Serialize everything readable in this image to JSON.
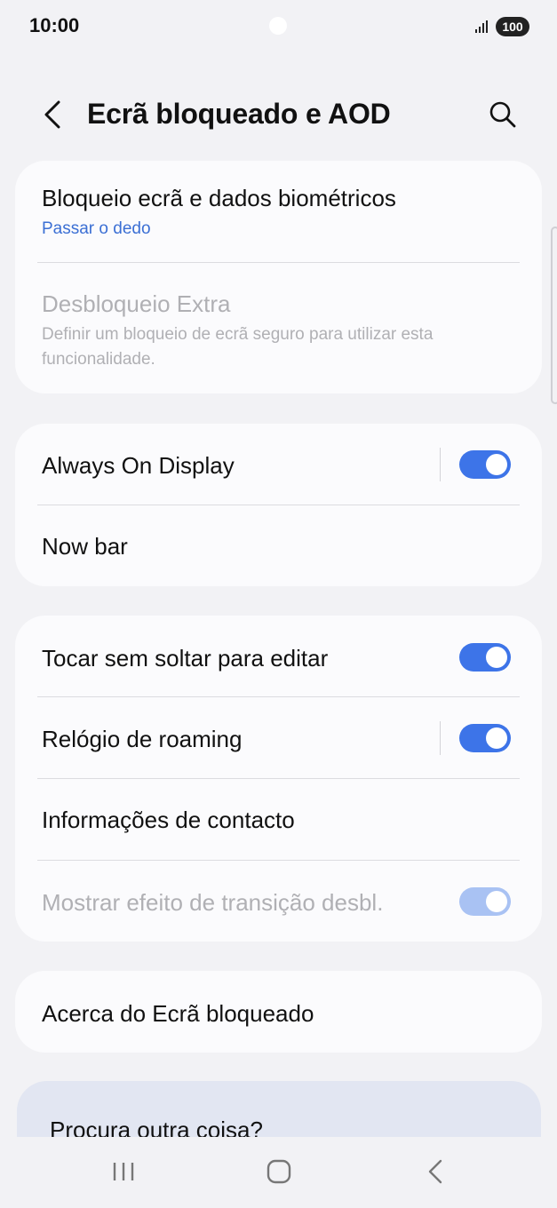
{
  "status_bar": {
    "time": "10:00",
    "battery": "100",
    "icons": [
      "signal-icon",
      "battery-icon"
    ]
  },
  "header": {
    "title": "Ecrã bloqueado e AOD",
    "back_icon": "back-chevron-icon",
    "search_icon": "search-icon"
  },
  "security_card": {
    "lock_title": "Bloqueio ecrã e dados biométricos",
    "lock_sub": "Passar o dedo",
    "extra_title": "Desbloqueio Extra",
    "extra_sub_line1": "Definir um bloqueio de ecrã seguro para utilizar esta",
    "extra_sub_line2": "funcionalidade."
  },
  "aod_card": {
    "aod_label": "Always On Display",
    "aod_on": true,
    "nowbar_label": "Now bar"
  },
  "settings_card": {
    "edit_label": "Tocar sem soltar para editar",
    "edit_on": true,
    "roaming_label": "Relógio de roaming",
    "roaming_on": true,
    "contact_label": "Informações de contacto",
    "transition_label": "Mostrar efeito de transição desbl.",
    "transition_on": true
  },
  "about_card": {
    "label": "Acerca do Ecrã bloqueado"
  },
  "suggest": {
    "label": "Procura outra coisa?"
  },
  "navbar": {
    "icons": [
      "recents-icon",
      "home-icon",
      "back-icon"
    ]
  },
  "colors": {
    "accent": "#3d74e8",
    "link": "#3b6fd4",
    "background": "#f2f2f5",
    "card": "#fbfbfd"
  }
}
